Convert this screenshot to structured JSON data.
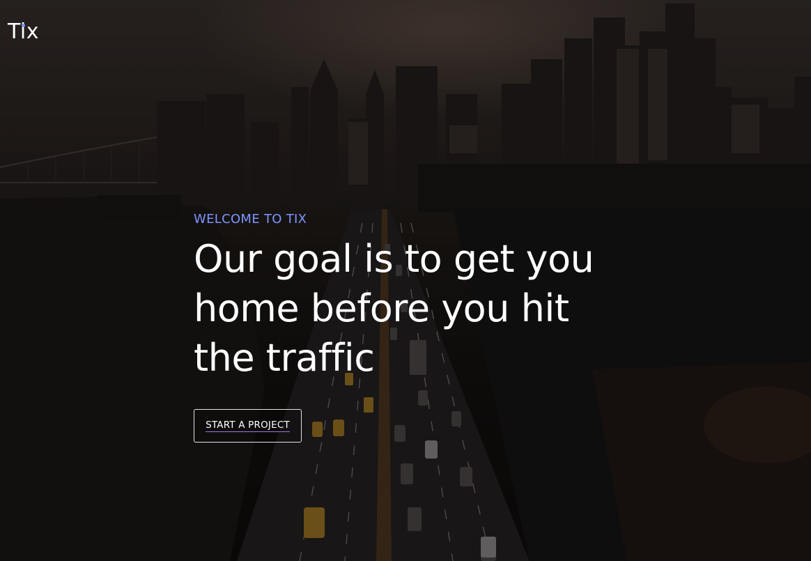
{
  "brand": {
    "name": "Tix",
    "accent_color": "#7f95ff"
  },
  "hero": {
    "eyebrow": "WELCOME TO TIX",
    "headline": "Our goal is to get you home before you hit the traffic",
    "cta_label": "START A PROJECT",
    "background_image": "city-skyline-traffic-photo"
  }
}
